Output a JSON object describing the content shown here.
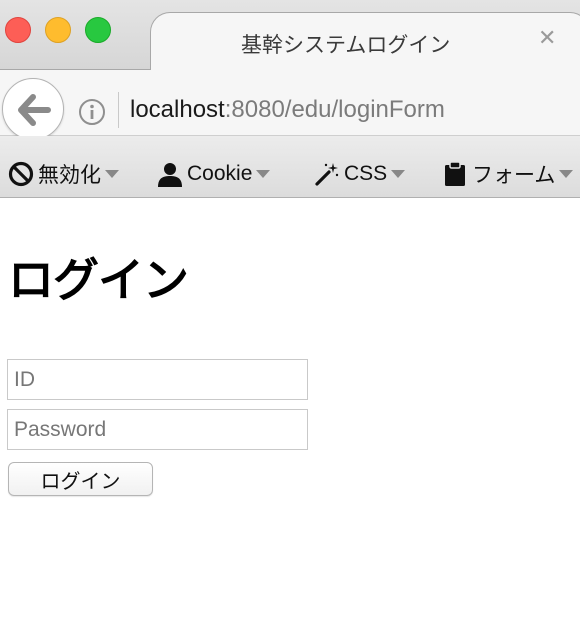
{
  "browser": {
    "tab_title": "基幹システムログイン",
    "tab_close_icon": "close-icon",
    "url_host": "localhost",
    "url_rest": ":8080/edu/loginForm"
  },
  "toolbar": {
    "items": [
      {
        "label": "無効化",
        "icon": "block-icon"
      },
      {
        "label": "Cookie",
        "icon": "user-icon"
      },
      {
        "label": "CSS",
        "icon": "magic-wand-icon"
      },
      {
        "label": "フォーム",
        "icon": "clipboard-icon"
      }
    ]
  },
  "page": {
    "heading": "ログイン",
    "id_placeholder": "ID",
    "password_placeholder": "Password",
    "login_button_label": "ログイン"
  },
  "colors": {
    "traffic_close": "#fd5e56",
    "traffic_minimize": "#febc2e",
    "traffic_maximize": "#28c840"
  }
}
